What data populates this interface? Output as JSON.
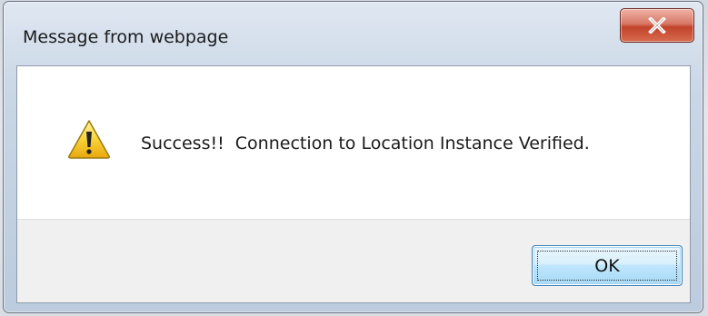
{
  "dialog": {
    "title": "Message from webpage",
    "message": "Success!!  Connection to Location Instance Verified.",
    "icon": "warning-icon",
    "ok_label": "OK",
    "close_icon": "close-icon"
  },
  "colors": {
    "warning_fill": "#f5c518",
    "close_button": "#c1432b",
    "ok_button_border": "#3c7fb1",
    "footer_bg": "#f0f0f0"
  }
}
